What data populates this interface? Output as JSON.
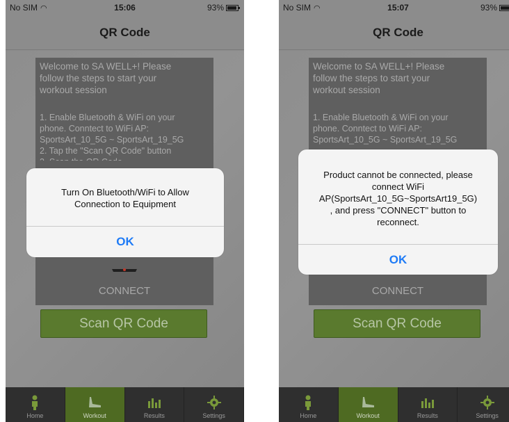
{
  "screens": [
    {
      "status": {
        "carrier": "No SIM",
        "time": "15:06",
        "battery": "93%"
      },
      "title": "QR Code",
      "info_text": "Welcome to SA WELL+! Please\nfollow the steps to start your\nworkout session",
      "hints": "1. Enable Bluetooth & WiFi on your\nphone. Conntect to WiFi AP:\nSportsArt_10_5G ~ SportsArt_19_5G\n2. Tap the \"Scan QR Code\" button\n3. Scan the QR Code",
      "connect_label": "CONNECT",
      "scan_button": "Scan QR Code",
      "alert": {
        "message": "Turn On Bluetooth/WiFi to Allow\nConnection to Equipment",
        "ok": "OK"
      }
    },
    {
      "status": {
        "carrier": "No SIM",
        "time": "15:07",
        "battery": "93%"
      },
      "title": "QR Code",
      "info_text": "Welcome to SA WELL+! Please\nfollow the steps to start your\nworkout session",
      "hints": "1. Enable Bluetooth & WiFi on your\nphone. Conntect to WiFi AP:\nSportsArt_10_5G ~ SportsArt_19_5G",
      "connect_label": "CONNECT",
      "scan_button": "Scan QR Code",
      "alert": {
        "message": "Product cannot be connected, please\nconnect WiFi\nAP(SportsArt_10_5G~SportsArt19_5G)\n, and press \"CONNECT\" button to\nreconnect.",
        "ok": "OK"
      }
    }
  ],
  "tabs": [
    {
      "label": "Home",
      "icon": "person-icon"
    },
    {
      "label": "Workout",
      "icon": "treadmill-icon"
    },
    {
      "label": "Results",
      "icon": "bar-chart-icon"
    },
    {
      "label": "Settings",
      "icon": "gear-icon"
    }
  ],
  "colors": {
    "accent_green": "#5a7a2e",
    "active_tab": "#4e6a22",
    "ios_blue": "#1e7bf6"
  }
}
